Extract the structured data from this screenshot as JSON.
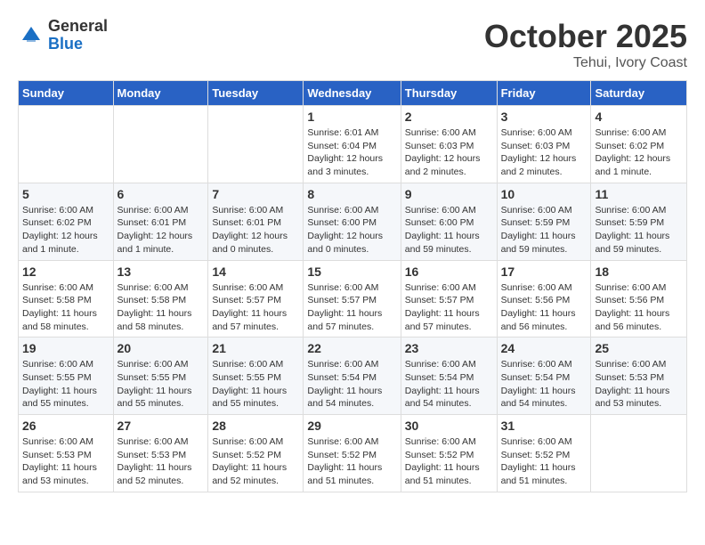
{
  "logo": {
    "general": "General",
    "blue": "Blue"
  },
  "title": "October 2025",
  "location": "Tehui, Ivory Coast",
  "weekdays": [
    "Sunday",
    "Monday",
    "Tuesday",
    "Wednesday",
    "Thursday",
    "Friday",
    "Saturday"
  ],
  "weeks": [
    [
      {
        "day": "",
        "info": ""
      },
      {
        "day": "",
        "info": ""
      },
      {
        "day": "",
        "info": ""
      },
      {
        "day": "1",
        "info": "Sunrise: 6:01 AM\nSunset: 6:04 PM\nDaylight: 12 hours and 3 minutes."
      },
      {
        "day": "2",
        "info": "Sunrise: 6:00 AM\nSunset: 6:03 PM\nDaylight: 12 hours and 2 minutes."
      },
      {
        "day": "3",
        "info": "Sunrise: 6:00 AM\nSunset: 6:03 PM\nDaylight: 12 hours and 2 minutes."
      },
      {
        "day": "4",
        "info": "Sunrise: 6:00 AM\nSunset: 6:02 PM\nDaylight: 12 hours and 1 minute."
      }
    ],
    [
      {
        "day": "5",
        "info": "Sunrise: 6:00 AM\nSunset: 6:02 PM\nDaylight: 12 hours and 1 minute."
      },
      {
        "day": "6",
        "info": "Sunrise: 6:00 AM\nSunset: 6:01 PM\nDaylight: 12 hours and 1 minute."
      },
      {
        "day": "7",
        "info": "Sunrise: 6:00 AM\nSunset: 6:01 PM\nDaylight: 12 hours and 0 minutes."
      },
      {
        "day": "8",
        "info": "Sunrise: 6:00 AM\nSunset: 6:00 PM\nDaylight: 12 hours and 0 minutes."
      },
      {
        "day": "9",
        "info": "Sunrise: 6:00 AM\nSunset: 6:00 PM\nDaylight: 11 hours and 59 minutes."
      },
      {
        "day": "10",
        "info": "Sunrise: 6:00 AM\nSunset: 5:59 PM\nDaylight: 11 hours and 59 minutes."
      },
      {
        "day": "11",
        "info": "Sunrise: 6:00 AM\nSunset: 5:59 PM\nDaylight: 11 hours and 59 minutes."
      }
    ],
    [
      {
        "day": "12",
        "info": "Sunrise: 6:00 AM\nSunset: 5:58 PM\nDaylight: 11 hours and 58 minutes."
      },
      {
        "day": "13",
        "info": "Sunrise: 6:00 AM\nSunset: 5:58 PM\nDaylight: 11 hours and 58 minutes."
      },
      {
        "day": "14",
        "info": "Sunrise: 6:00 AM\nSunset: 5:57 PM\nDaylight: 11 hours and 57 minutes."
      },
      {
        "day": "15",
        "info": "Sunrise: 6:00 AM\nSunset: 5:57 PM\nDaylight: 11 hours and 57 minutes."
      },
      {
        "day": "16",
        "info": "Sunrise: 6:00 AM\nSunset: 5:57 PM\nDaylight: 11 hours and 57 minutes."
      },
      {
        "day": "17",
        "info": "Sunrise: 6:00 AM\nSunset: 5:56 PM\nDaylight: 11 hours and 56 minutes."
      },
      {
        "day": "18",
        "info": "Sunrise: 6:00 AM\nSunset: 5:56 PM\nDaylight: 11 hours and 56 minutes."
      }
    ],
    [
      {
        "day": "19",
        "info": "Sunrise: 6:00 AM\nSunset: 5:55 PM\nDaylight: 11 hours and 55 minutes."
      },
      {
        "day": "20",
        "info": "Sunrise: 6:00 AM\nSunset: 5:55 PM\nDaylight: 11 hours and 55 minutes."
      },
      {
        "day": "21",
        "info": "Sunrise: 6:00 AM\nSunset: 5:55 PM\nDaylight: 11 hours and 55 minutes."
      },
      {
        "day": "22",
        "info": "Sunrise: 6:00 AM\nSunset: 5:54 PM\nDaylight: 11 hours and 54 minutes."
      },
      {
        "day": "23",
        "info": "Sunrise: 6:00 AM\nSunset: 5:54 PM\nDaylight: 11 hours and 54 minutes."
      },
      {
        "day": "24",
        "info": "Sunrise: 6:00 AM\nSunset: 5:54 PM\nDaylight: 11 hours and 54 minutes."
      },
      {
        "day": "25",
        "info": "Sunrise: 6:00 AM\nSunset: 5:53 PM\nDaylight: 11 hours and 53 minutes."
      }
    ],
    [
      {
        "day": "26",
        "info": "Sunrise: 6:00 AM\nSunset: 5:53 PM\nDaylight: 11 hours and 53 minutes."
      },
      {
        "day": "27",
        "info": "Sunrise: 6:00 AM\nSunset: 5:53 PM\nDaylight: 11 hours and 52 minutes."
      },
      {
        "day": "28",
        "info": "Sunrise: 6:00 AM\nSunset: 5:52 PM\nDaylight: 11 hours and 52 minutes."
      },
      {
        "day": "29",
        "info": "Sunrise: 6:00 AM\nSunset: 5:52 PM\nDaylight: 11 hours and 51 minutes."
      },
      {
        "day": "30",
        "info": "Sunrise: 6:00 AM\nSunset: 5:52 PM\nDaylight: 11 hours and 51 minutes."
      },
      {
        "day": "31",
        "info": "Sunrise: 6:00 AM\nSunset: 5:52 PM\nDaylight: 11 hours and 51 minutes."
      },
      {
        "day": "",
        "info": ""
      }
    ]
  ]
}
